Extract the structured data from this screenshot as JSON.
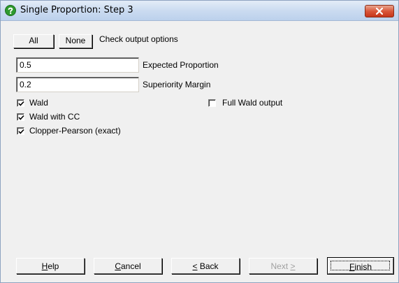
{
  "window": {
    "title": "Single Proportion: Step 3",
    "title_icon": "question-icon",
    "close_icon": "close-icon"
  },
  "toolbar": {
    "all_label": "All",
    "none_label": "None",
    "check_label": "Check output options"
  },
  "fields": {
    "expected_value": "0.5",
    "expected_label": "Expected Proportion",
    "margin_value": "0.2",
    "margin_label": "Superiority Margin"
  },
  "options": [
    {
      "label": "Wald",
      "checked": true
    },
    {
      "label": "Wald with CC",
      "checked": true
    },
    {
      "label": "Clopper-Pearson (exact)",
      "checked": true
    },
    {
      "label": "Full Wald output",
      "checked": false
    }
  ],
  "footer": {
    "help": {
      "pre": "",
      "key": "H",
      "post": "elp",
      "enabled": true
    },
    "cancel": {
      "pre": "",
      "key": "C",
      "post": "ancel",
      "enabled": true
    },
    "back": {
      "pre": "",
      "key": "<",
      "post": " Back",
      "enabled": true
    },
    "next": {
      "pre": "Next ",
      "key": ">",
      "post": "",
      "enabled": false
    },
    "finish": {
      "pre": "",
      "key": "F",
      "post": "inish",
      "enabled": true
    }
  },
  "colors": {
    "title_bar": "#c9daf0",
    "close_button": "#d9573a",
    "dialog_bg": "#f0f0f0",
    "disabled_text": "#a0a0a0"
  }
}
